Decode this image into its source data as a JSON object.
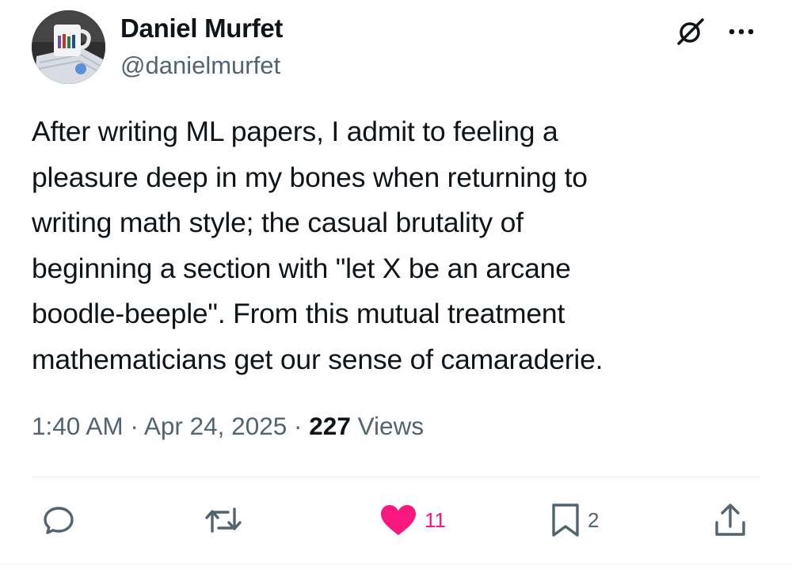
{
  "author": {
    "display_name": "Daniel Murfet",
    "handle": "@danielmurfet",
    "avatar_icon": "avatar-photo-mug"
  },
  "header_icons": {
    "grok": "grok-icon",
    "more": "more-options-icon"
  },
  "tweet": {
    "text": "After writing ML papers, I admit to feeling a\npleasure deep in my bones when returning to\nwriting math style; the casual brutality of\nbeginning a section with \"let X be an arcane\nboodle-beeple\". From this mutual treatment\nmathematicians get our sense of camaraderie."
  },
  "meta": {
    "time": "1:40 AM",
    "separator": "·",
    "date": "Apr 24, 2025",
    "views_count": "227",
    "views_label": "Views"
  },
  "actions": {
    "reply": {
      "icon": "reply-icon",
      "count": ""
    },
    "repost": {
      "icon": "repost-icon",
      "count": ""
    },
    "like": {
      "icon": "heart-icon",
      "count": "11",
      "liked": true
    },
    "bookmark": {
      "icon": "bookmark-icon",
      "count": "2"
    },
    "share": {
      "icon": "share-icon",
      "count": ""
    }
  },
  "colors": {
    "text": "#0f1419",
    "secondary": "#536471",
    "like_active": "#f91880",
    "divider": "#e6ecf0"
  }
}
